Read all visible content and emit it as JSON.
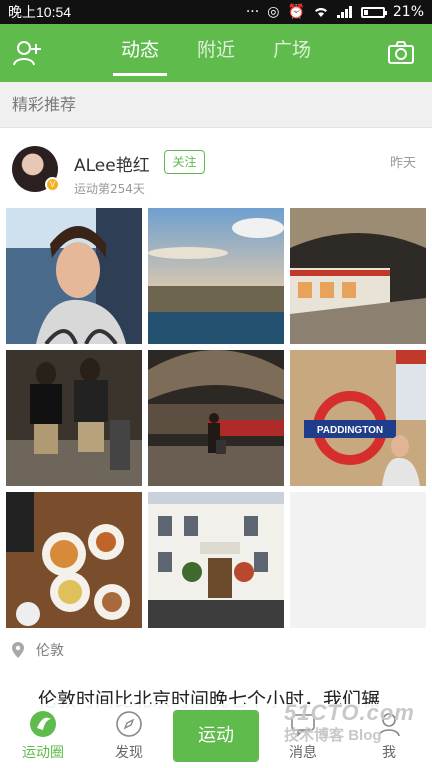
{
  "status_bar": {
    "time": "晚上10:54",
    "battery": "21%",
    "battery_level": 0.21
  },
  "top_bar": {
    "tabs": [
      {
        "label": "动态",
        "active": true
      },
      {
        "label": "附近",
        "active": false
      },
      {
        "label": "广场",
        "active": false
      }
    ],
    "left_icon": "add-friend-icon",
    "right_icon": "camera-icon"
  },
  "section": {
    "title": "精彩推荐"
  },
  "post": {
    "username": "ALee艳红",
    "follow_label": "关注",
    "subtitle": "运动第254天",
    "time_ago": "昨天",
    "location": "伦敦",
    "text": "伦敦时间比北京时间晚七个小时，我们辗",
    "photos": [
      "selfie-on-train",
      "aerial-coast-view",
      "underground-station-platform",
      "couple-on-platform",
      "station-hall-traveler",
      "paddington-sign",
      "breakfast-table",
      "white-townhouses",
      "empty"
    ]
  },
  "bottom_nav": [
    {
      "label": "运动圈",
      "icon": "circle-icon",
      "active": true
    },
    {
      "label": "发现",
      "icon": "compass-icon",
      "active": false
    },
    {
      "label": "运动",
      "icon": "",
      "active": false
    },
    {
      "label": "消息",
      "icon": "message-icon",
      "active": false
    },
    {
      "label": "我",
      "icon": "profile-icon",
      "active": false
    }
  ],
  "watermark": {
    "line1": "51CTO.com",
    "line2": "技术博客",
    "line3": "Blog"
  },
  "colors": {
    "brand": "#5fbb4c"
  }
}
